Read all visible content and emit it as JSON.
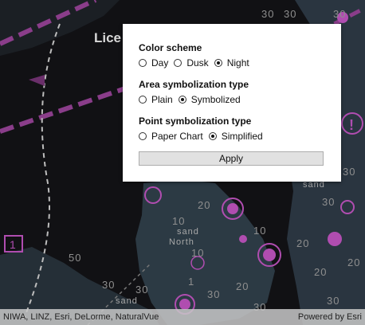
{
  "map": {
    "place_label": "Lice",
    "area_label_1": "sand",
    "area_label_2": "North",
    "area_label_3": "sand",
    "area_label_4": "sand",
    "depths": [
      "30",
      "30",
      "30",
      "30",
      "30",
      "50",
      "20",
      "10",
      "10",
      "20",
      "30",
      "30",
      "20",
      "10",
      "20",
      "20",
      "1",
      "30",
      "30",
      "30"
    ]
  },
  "panel": {
    "color_scheme": {
      "title": "Color scheme",
      "options": [
        "Day",
        "Dusk",
        "Night"
      ],
      "selected": "Night"
    },
    "area_type": {
      "title": "Area symbolization type",
      "options": [
        "Plain",
        "Symbolized"
      ],
      "selected": "Symbolized"
    },
    "point_type": {
      "title": "Point symbolization type",
      "options": [
        "Paper Chart",
        "Simplified"
      ],
      "selected": "Simplified"
    },
    "apply_label": "Apply"
  },
  "attribution": {
    "sources": "NIWA, LINZ, Esri, DeLorme, NaturalVue",
    "powered_by": "Powered by Esri"
  },
  "colors": {
    "chart_magenta": "#8a3d8a",
    "land_gray": "#2c3a44",
    "water_dark": "#0f0f12",
    "panel_bg": "#ffffff"
  }
}
